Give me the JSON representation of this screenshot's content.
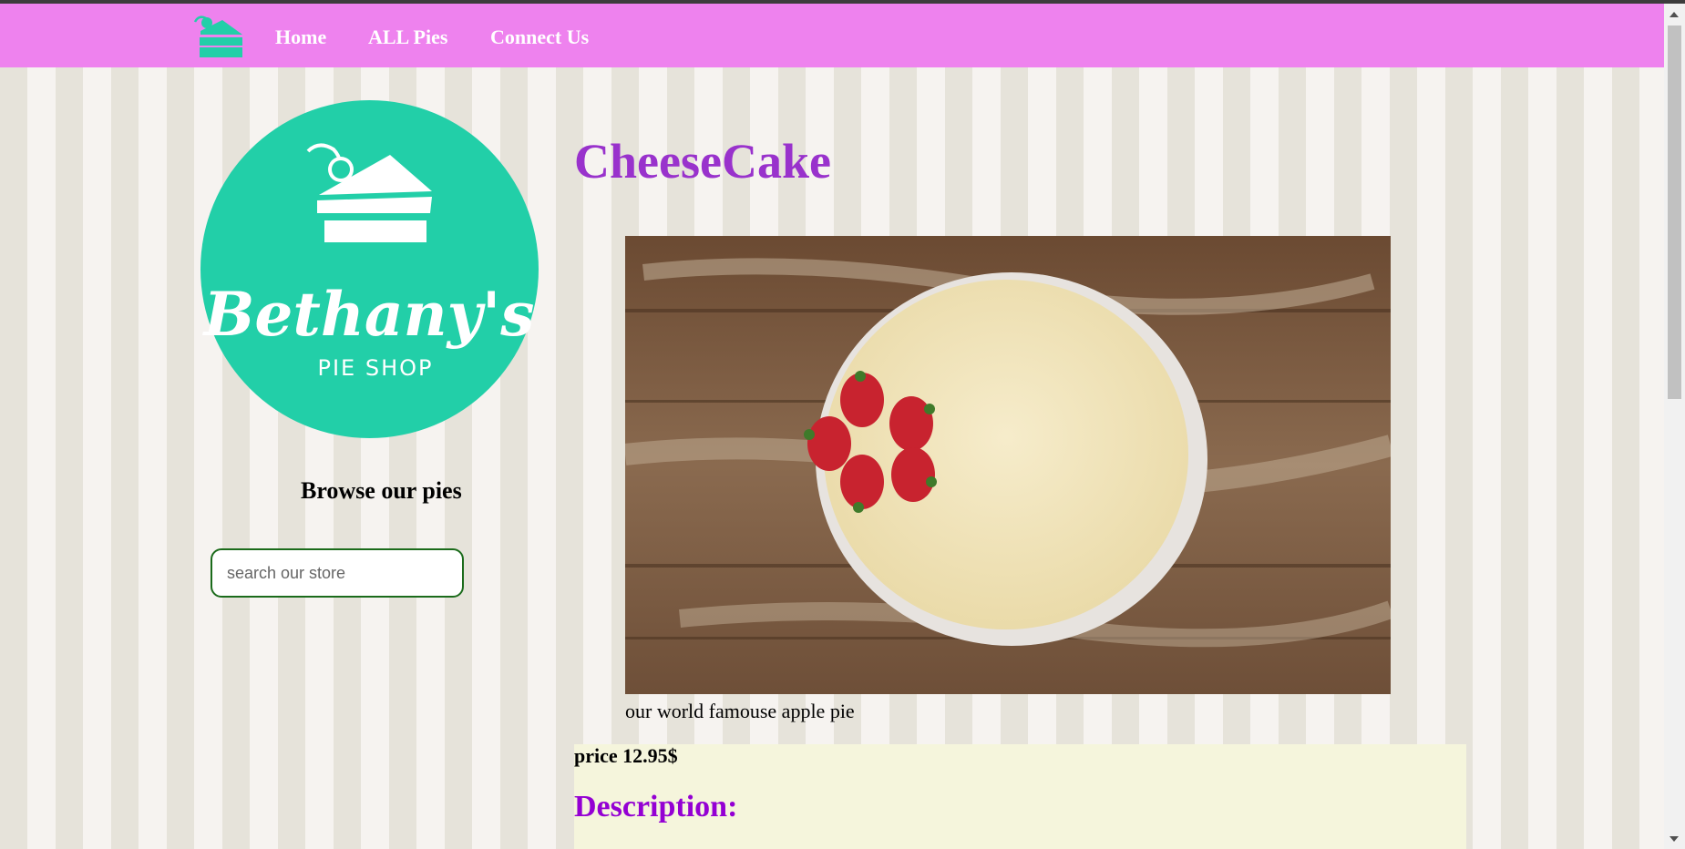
{
  "colors": {
    "navbar": "#ee82ee",
    "brand_teal": "#22cfa8",
    "title_purple": "#9932cc",
    "description_purple": "#9400d3",
    "panel_beige": "#f5f5dc"
  },
  "nav": {
    "logo_icon": "cake-slice-icon",
    "links": [
      "Home",
      "ALL Pies",
      "Connect Us"
    ]
  },
  "brand": {
    "name": "Bethany's",
    "tagline": "PIE SHOP"
  },
  "sidebar": {
    "browse_title": "Browse our pies",
    "search_placeholder": "search our store"
  },
  "product": {
    "title": "CheeseCake",
    "image_alt": "cheesecake with strawberries on wooden table",
    "caption": "our world famouse apple pie",
    "price": "price 12.95$",
    "description_heading": "Description:"
  }
}
